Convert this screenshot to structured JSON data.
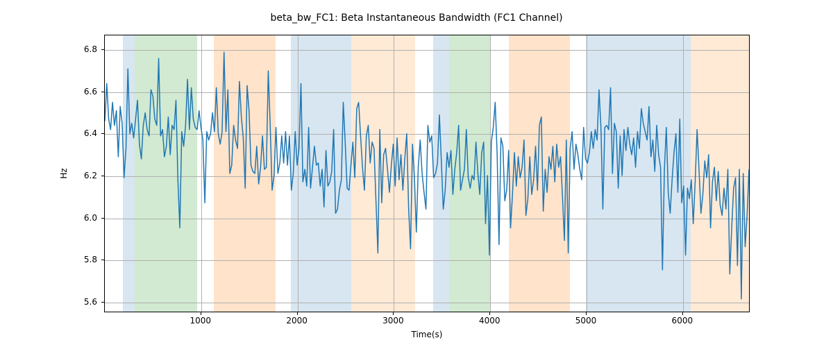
{
  "chart_data": {
    "type": "line",
    "title": "beta_bw_FC1: Beta Instantaneous Bandwidth (FC1 Channel)",
    "xlabel": "Time(s)",
    "ylabel": "Hz",
    "xlim": [
      0,
      6700
    ],
    "ylim": [
      5.55,
      6.87
    ],
    "xticks": [
      1000,
      2000,
      3000,
      4000,
      5000,
      6000
    ],
    "yticks": [
      5.6,
      5.8,
      6.0,
      6.2,
      6.4,
      6.6,
      6.8
    ],
    "bands": [
      {
        "start": 190,
        "end": 310,
        "color": "blue"
      },
      {
        "start": 310,
        "end": 960,
        "color": "green"
      },
      {
        "start": 1130,
        "end": 1770,
        "color": "orange"
      },
      {
        "start": 1930,
        "end": 2560,
        "color": "blue"
      },
      {
        "start": 2560,
        "end": 3220,
        "color": "peach"
      },
      {
        "start": 3410,
        "end": 3570,
        "color": "blue"
      },
      {
        "start": 3570,
        "end": 4000,
        "color": "green"
      },
      {
        "start": 4190,
        "end": 4830,
        "color": "orange"
      },
      {
        "start": 4990,
        "end": 6080,
        "color": "blue"
      },
      {
        "start": 6080,
        "end": 6700,
        "color": "peach"
      }
    ],
    "x": [
      0,
      20,
      40,
      60,
      80,
      100,
      120,
      140,
      160,
      180,
      200,
      220,
      240,
      260,
      280,
      300,
      320,
      340,
      360,
      380,
      400,
      420,
      440,
      460,
      480,
      500,
      520,
      540,
      560,
      580,
      600,
      620,
      640,
      660,
      680,
      700,
      720,
      740,
      760,
      780,
      800,
      820,
      840,
      860,
      880,
      900,
      920,
      940,
      960,
      980,
      1000,
      1020,
      1040,
      1060,
      1080,
      1100,
      1120,
      1140,
      1160,
      1180,
      1200,
      1220,
      1240,
      1260,
      1280,
      1300,
      1320,
      1340,
      1360,
      1380,
      1400,
      1420,
      1440,
      1460,
      1480,
      1500,
      1520,
      1540,
      1560,
      1580,
      1600,
      1620,
      1640,
      1660,
      1680,
      1700,
      1720,
      1740,
      1760,
      1780,
      1800,
      1820,
      1840,
      1860,
      1880,
      1900,
      1920,
      1940,
      1960,
      1980,
      2000,
      2020,
      2040,
      2060,
      2080,
      2100,
      2120,
      2140,
      2160,
      2180,
      2200,
      2220,
      2240,
      2260,
      2280,
      2300,
      2320,
      2340,
      2360,
      2380,
      2400,
      2420,
      2440,
      2460,
      2480,
      2500,
      2520,
      2540,
      2560,
      2580,
      2600,
      2620,
      2640,
      2660,
      2680,
      2700,
      2720,
      2740,
      2760,
      2780,
      2800,
      2820,
      2840,
      2860,
      2880,
      2900,
      2920,
      2940,
      2960,
      2980,
      3000,
      3020,
      3040,
      3060,
      3080,
      3100,
      3120,
      3140,
      3160,
      3180,
      3200,
      3220,
      3240,
      3260,
      3280,
      3300,
      3320,
      3340,
      3360,
      3380,
      3400,
      3420,
      3440,
      3460,
      3480,
      3500,
      3520,
      3540,
      3560,
      3580,
      3600,
      3620,
      3640,
      3660,
      3680,
      3700,
      3720,
      3740,
      3760,
      3780,
      3800,
      3820,
      3840,
      3860,
      3880,
      3900,
      3920,
      3940,
      3960,
      3980,
      4000,
      4020,
      4040,
      4060,
      4080,
      4100,
      4120,
      4140,
      4160,
      4180,
      4200,
      4220,
      4240,
      4260,
      4280,
      4300,
      4320,
      4340,
      4360,
      4380,
      4400,
      4420,
      4440,
      4460,
      4480,
      4500,
      4520,
      4540,
      4560,
      4580,
      4600,
      4620,
      4640,
      4660,
      4680,
      4700,
      4720,
      4740,
      4760,
      4780,
      4800,
      4820,
      4840,
      4860,
      4880,
      4900,
      4920,
      4940,
      4960,
      4980,
      5000,
      5020,
      5040,
      5060,
      5080,
      5100,
      5120,
      5140,
      5160,
      5180,
      5200,
      5220,
      5240,
      5260,
      5280,
      5300,
      5320,
      5340,
      5360,
      5380,
      5400,
      5420,
      5440,
      5460,
      5480,
      5500,
      5520,
      5540,
      5560,
      5580,
      5600,
      5620,
      5640,
      5660,
      5680,
      5700,
      5720,
      5740,
      5760,
      5780,
      5800,
      5820,
      5840,
      5860,
      5880,
      5900,
      5920,
      5940,
      5960,
      5980,
      6000,
      6020,
      6040,
      6060,
      6080,
      6100,
      6120,
      6140,
      6160,
      6180,
      6200,
      6220,
      6240,
      6260,
      6280,
      6300,
      6320,
      6340,
      6360,
      6380,
      6400,
      6420,
      6440,
      6460,
      6480,
      6500,
      6520,
      6540,
      6560,
      6580,
      6600,
      6620,
      6640,
      6660,
      6680,
      6700
    ],
    "values": [
      6.46,
      6.64,
      6.47,
      6.42,
      6.55,
      6.44,
      6.51,
      6.29,
      6.53,
      6.45,
      6.19,
      6.33,
      6.71,
      6.4,
      6.45,
      6.38,
      6.47,
      6.56,
      6.35,
      6.28,
      6.44,
      6.5,
      6.42,
      6.39,
      6.61,
      6.58,
      6.47,
      6.44,
      6.76,
      6.39,
      6.42,
      6.29,
      6.34,
      6.48,
      6.3,
      6.44,
      6.42,
      6.56,
      6.18,
      5.95,
      6.41,
      6.34,
      6.44,
      6.66,
      6.42,
      6.62,
      6.47,
      6.43,
      6.42,
      6.51,
      6.43,
      6.37,
      6.07,
      6.41,
      6.37,
      6.4,
      6.5,
      6.41,
      6.62,
      6.4,
      6.35,
      6.41,
      6.79,
      6.41,
      6.61,
      6.21,
      6.25,
      6.44,
      6.37,
      6.33,
      6.65,
      6.48,
      6.38,
      6.14,
      6.63,
      6.51,
      6.25,
      6.22,
      6.21,
      6.34,
      6.16,
      6.24,
      6.39,
      6.23,
      6.24,
      6.7,
      6.44,
      6.13,
      6.2,
      6.43,
      6.21,
      6.26,
      6.39,
      6.26,
      6.41,
      6.25,
      6.39,
      6.13,
      6.21,
      6.41,
      6.25,
      6.33,
      6.64,
      6.17,
      6.23,
      6.15,
      6.43,
      6.14,
      6.24,
      6.34,
      6.25,
      6.26,
      6.15,
      6.23,
      6.05,
      6.32,
      6.15,
      6.17,
      6.22,
      6.42,
      6.02,
      6.04,
      6.13,
      6.18,
      6.55,
      6.36,
      6.14,
      6.13,
      6.25,
      6.36,
      6.19,
      6.52,
      6.55,
      6.39,
      6.24,
      6.13,
      6.39,
      6.44,
      6.26,
      6.36,
      6.33,
      6.08,
      5.83,
      6.42,
      6.07,
      6.3,
      6.33,
      6.23,
      6.12,
      6.25,
      6.35,
      6.15,
      6.38,
      6.18,
      6.3,
      6.13,
      6.28,
      6.4,
      6.04,
      5.85,
      6.35,
      6.19,
      5.93,
      6.24,
      6.37,
      6.21,
      6.12,
      6.04,
      6.44,
      6.36,
      6.39,
      6.19,
      6.21,
      6.26,
      6.49,
      6.27,
      6.04,
      6.13,
      6.31,
      6.24,
      6.32,
      6.11,
      6.23,
      6.31,
      6.44,
      6.13,
      6.18,
      6.23,
      6.42,
      6.19,
      6.14,
      6.2,
      6.18,
      6.36,
      6.21,
      6.11,
      6.31,
      6.36,
      5.97,
      6.2,
      5.82,
      6.36,
      6.43,
      6.55,
      6.31,
      5.87,
      6.38,
      6.34,
      6.08,
      6.13,
      6.32,
      5.95,
      6.11,
      6.31,
      6.15,
      6.29,
      6.19,
      6.24,
      6.37,
      6.01,
      6.09,
      6.29,
      6.11,
      6.18,
      6.34,
      6.13,
      6.44,
      6.48,
      6.03,
      6.23,
      6.12,
      6.29,
      6.23,
      6.34,
      6.17,
      6.35,
      6.24,
      6.29,
      6.1,
      5.89,
      6.37,
      5.83,
      6.33,
      6.41,
      6.23,
      6.35,
      6.3,
      6.23,
      6.18,
      6.43,
      6.28,
      6.26,
      6.31,
      6.41,
      6.33,
      6.42,
      6.37,
      6.61,
      6.43,
      6.04,
      6.43,
      6.44,
      6.42,
      6.62,
      6.21,
      6.45,
      6.41,
      6.14,
      6.39,
      6.2,
      6.42,
      6.32,
      6.43,
      6.35,
      6.3,
      6.38,
      6.24,
      6.41,
      6.33,
      6.52,
      6.45,
      6.41,
      6.37,
      6.53,
      6.29,
      6.37,
      6.22,
      6.44,
      6.3,
      6.24,
      5.75,
      6.23,
      6.43,
      6.12,
      6.02,
      6.18,
      6.31,
      6.4,
      6.12,
      6.47,
      6.07,
      6.15,
      5.82,
      6.14,
      6.09,
      6.18,
      5.97,
      6.17,
      6.42,
      6.23,
      6.02,
      6.11,
      6.27,
      6.19,
      6.3,
      5.95,
      6.17,
      6.24,
      6.08,
      6.22,
      6.06,
      6.01,
      6.14,
      6.04,
      6.23,
      5.73,
      5.95,
      6.14,
      6.19,
      5.77,
      6.23,
      5.61,
      6.21,
      5.86,
      6.01,
      6.23
    ],
    "line_color": "#1f77b4"
  }
}
